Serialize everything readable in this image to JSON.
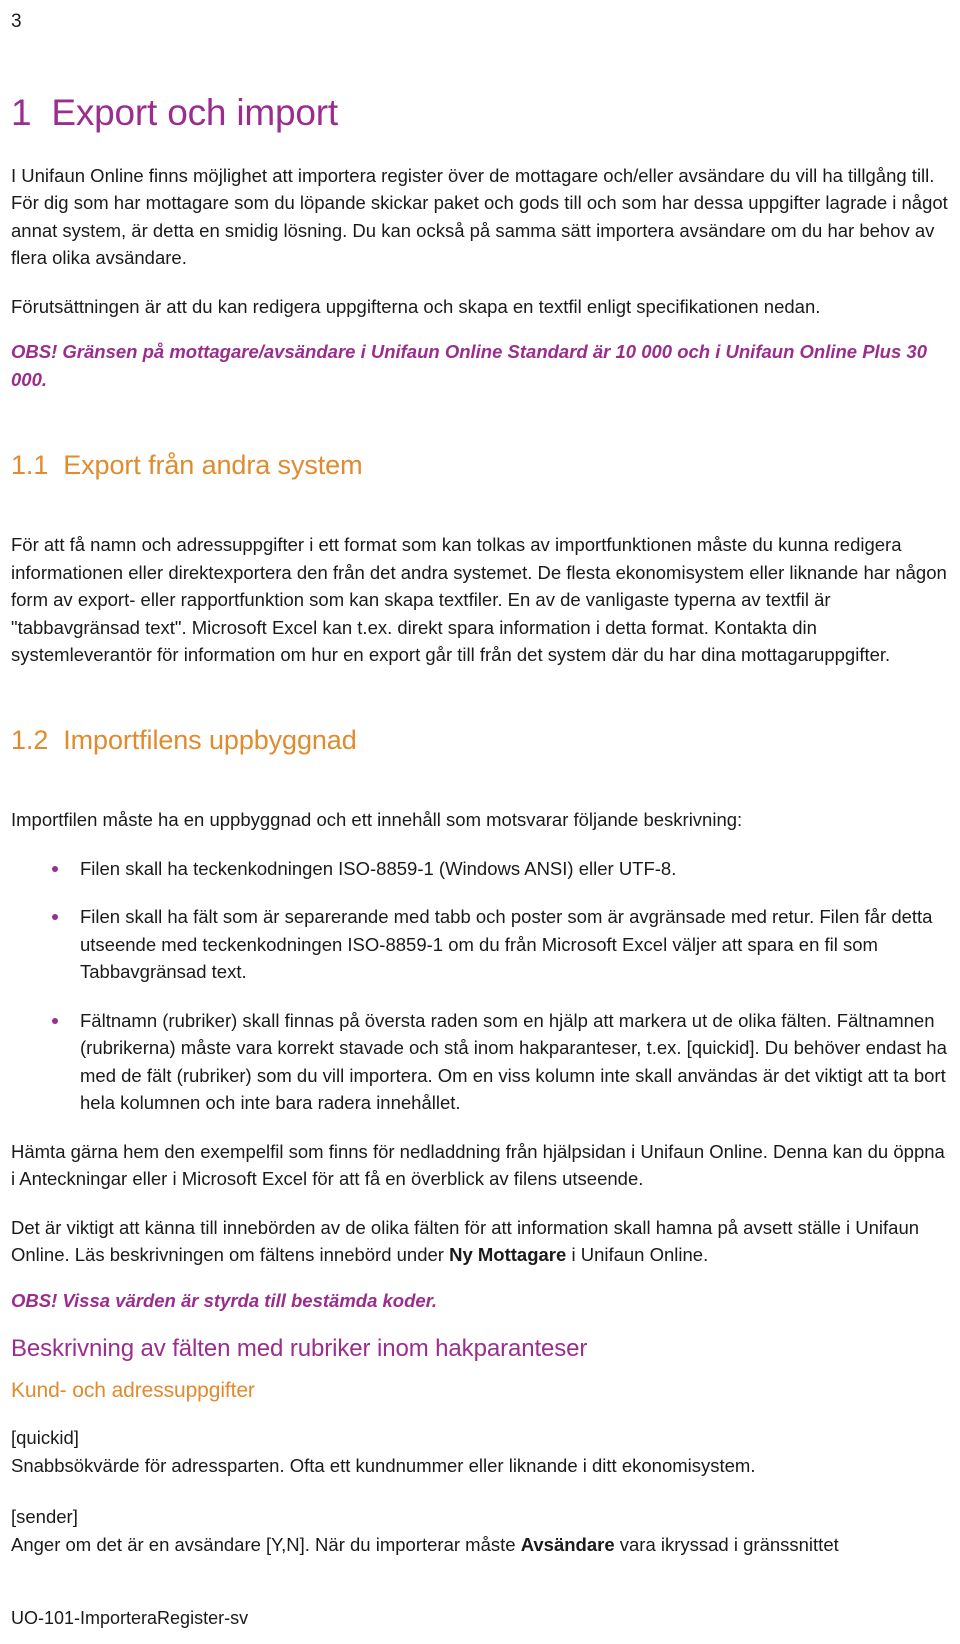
{
  "document": {
    "page_number": "3",
    "footer": "UO-101-ImporteraRegister-sv",
    "colors": {
      "heading_purple": "#9B2D8E",
      "heading_orange": "#E08B2D",
      "body_text": "#1A1A1A",
      "bullet": "#9B2D8E"
    }
  },
  "chapter": {
    "number": "1",
    "title": "Export och import",
    "intro_paragraph": "I Unifaun Online finns möjlighet att importera register över de mottagare och/eller avsändare du vill ha tillgång till. För dig som har mottagare som du löpande skickar paket och gods till och som har dessa uppgifter lagrade i något annat system, är detta en smidig lösning. Du kan också på samma sätt importera avsändare om du har behov av flera olika avsändare.",
    "precondition_paragraph": "Förutsättningen är att du kan redigera uppgifterna och skapa en textfil enligt specifikationen nedan.",
    "obs_limits": "OBS! Gränsen på mottagare/avsändare i Unifaun Online Standard är 10 000 och i Unifaun Online Plus 30 000."
  },
  "section_1_1": {
    "number": "1.1",
    "title": "Export från andra system",
    "paragraph": "För att få namn och adressuppgifter i ett format som kan tolkas av importfunktionen måste du kunna redigera informationen eller direktexportera den från det andra systemet. De flesta ekonomisystem eller liknande har någon form av export- eller rapportfunktion som kan skapa textfiler. En av de vanligaste typerna av textfil är \"tabbavgränsad text\". Microsoft Excel kan t.ex. direkt spara information i detta format. Kontakta din systemleverantör för information om hur en export går till från det system där du har dina mottagaruppgifter."
  },
  "section_1_2": {
    "number": "1.2",
    "title": "Importfilens uppbyggnad",
    "intro": "Importfilen måste ha en uppbyggnad och ett innehåll som motsvarar följande beskrivning:",
    "bullets": [
      "Filen skall ha teckenkodningen ISO-8859-1 (Windows ANSI) eller UTF-8.",
      "Filen skall ha fält som är separerande med tabb och poster som är avgränsade med retur. Filen får detta utseende med teckenkodningen ISO-8859-1 om du från Microsoft Excel väljer att spara en fil som Tabbavgränsad text.",
      "Fältnamn (rubriker) skall finnas på översta raden som en hjälp att markera ut de olika fälten. Fältnamnen (rubrikerna) måste vara korrekt stavade och stå inom hakparanteser, t.ex. [quickid]. Du behöver endast ha med de fält (rubriker) som du vill importera. Om en viss kolumn inte skall användas är det viktigt att ta bort hela kolumnen och inte bara radera innehållet."
    ],
    "paragraph_sample_file": "Hämta gärna hem den exempelfil som finns för nedladdning från hjälpsidan i Unifaun Online. Denna kan du öppna i Anteckningar eller i Microsoft Excel för att få en överblick av filens utseende.",
    "paragraph_fields_pre": "Det är viktigt att känna till innebörden av de olika fälten för att information skall hamna på avsett ställe i Unifaun Online. Läs beskrivningen om fältens innebörd under ",
    "paragraph_fields_bold": "Ny Mottagare",
    "paragraph_fields_post": " i Unifaun Online.",
    "obs_codes": "OBS! Vissa värden är styrda till bestämda koder."
  },
  "field_description": {
    "heading": "Beskrivning av fälten med rubriker inom hakparanteser",
    "subheading": "Kund- och adressuppgifter",
    "fields": [
      {
        "name": "[quickid]",
        "description": "Snabbsökvärde för adressparten. Ofta ett kundnummer eller liknande i ditt ekonomisystem."
      },
      {
        "name": "[sender]",
        "description_pre": "Anger om det är en avsändare [Y,N]. När du importerar måste ",
        "description_bold": "Avsändare",
        "description_post": " vara ikryssad i gränssnittet"
      }
    ]
  }
}
